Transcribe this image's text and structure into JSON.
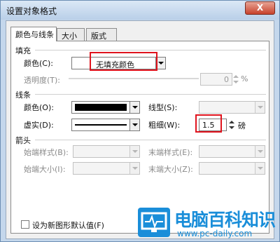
{
  "window": {
    "title": "设置对象格式",
    "close_symbol": "X"
  },
  "tabs": [
    {
      "label": "颜色与线条"
    },
    {
      "label": "大小"
    },
    {
      "label": "版式"
    }
  ],
  "fill": {
    "group_title": "填充",
    "color_label": "颜色(C):",
    "color_value": "无填充颜色",
    "transparency_label": "透明度(T):",
    "transparency_value": "0",
    "transparency_unit": "%"
  },
  "line": {
    "group_title": "线条",
    "color_label": "颜色(O):",
    "line_type_label": "线型(S):",
    "dash_label": "虚实(D):",
    "weight_label": "粗细(W):",
    "weight_value": "1.5",
    "weight_unit": "磅",
    "line_color": "#000000"
  },
  "arrows": {
    "group_title": "箭头",
    "begin_style_label": "始端样式(B):",
    "end_style_label": "末端样式(E):",
    "begin_size_label": "始端大小(I):",
    "end_size_label": "末端大小(Z):"
  },
  "default_checkbox": {
    "label": "设为新图形默认值(F)"
  },
  "watermark": {
    "title": "电脑百科知识",
    "url": "www.pc-daily.com"
  },
  "colors": {
    "highlight": "#e0141e",
    "watermark": "#1a8ed9"
  }
}
